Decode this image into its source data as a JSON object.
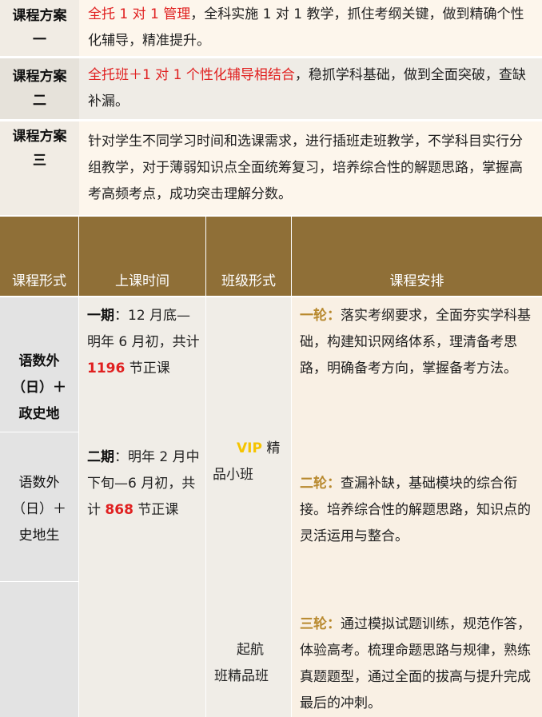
{
  "plans": [
    {
      "label1": "课程方案",
      "label2": "一",
      "highlight": "全托 1 对 1 管理",
      "text": "，全科实施 1 对 1 教学，抓住考纲关键，做到精确个性化辅导，精准提升。"
    },
    {
      "label1": "课程方案",
      "label2": "二",
      "highlight": "全托班＋1 对 1 个性化辅导相结合",
      "text": "，稳抓学科基础，做到全面突破，查缺补漏。"
    },
    {
      "label1": "课程方案",
      "label2": "三",
      "highlight": "",
      "text": "针对学生不同学习时间和选课需求，进行插班走班教学，不学科目实行分组教学，对于薄弱知识点全面统筹复习，培养综合性的解题思路，掌握高考高频考点，成功突击理解分数。"
    }
  ],
  "table": {
    "headers": [
      "课程形式",
      "上课时间",
      "班级形式",
      "课程安排"
    ],
    "forms": [
      {
        "line1": "语数外",
        "line2": "（日）＋",
        "line3": "政史地"
      },
      {
        "line1": "语数外",
        "line2": "（日）＋",
        "line3": "史地生"
      }
    ],
    "phase1": {
      "label": "一期",
      "text_a": "：12 月底—明年 6 月初，共计 ",
      "count": "1196",
      "text_b": " 节正课"
    },
    "phase2": {
      "label": "二期",
      "text_a": "：明年 2 月中下旬—6 月初，共计 ",
      "count": "868",
      "text_b": " 节正课"
    },
    "class1": {
      "vip": "VIP",
      "rest": " 精品小班"
    },
    "class2": {
      "line1": "起航",
      "line2": "班精品班"
    },
    "rounds": [
      {
        "label": "一轮：",
        "text": "落实考纲要求，全面夯实学科基础，构建知识网络体系，理清备考思路，明确备考方向，掌握备考方法。"
      },
      {
        "label": "二轮：",
        "text": "查漏补缺，基础模块的综合衔接。培养综合性的解题思路，知识点的灵活运用与整合。"
      },
      {
        "label": "三轮：",
        "text": "通过模拟试题训练，规范作答，体验高考。梳理命题思路与规律，熟练真题题型，通过全面的拔高与提升完成最后的冲刺。"
      }
    ]
  },
  "colors": {
    "header_bg": "#8f6f37",
    "highlight_red": "#e02020",
    "round_gold": "#b8892e",
    "plan_bg_a": "#fdf6ec",
    "plan_bg_b": "#f1eee8",
    "form_bg": "#e3e3e3",
    "body_bg": "#f0ede7",
    "arrange_bg": "#f9f0e4"
  }
}
